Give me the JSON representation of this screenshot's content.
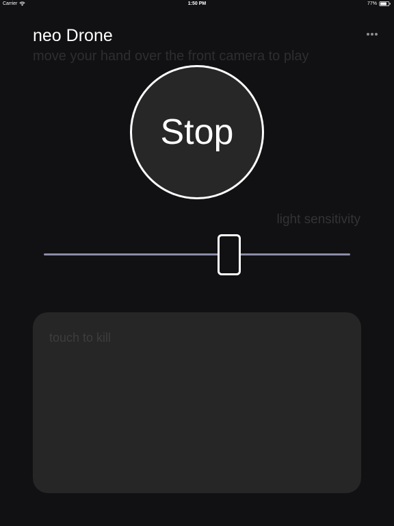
{
  "status_bar": {
    "carrier": "Carrier",
    "time": "1:50 PM",
    "battery": "77%",
    "battery_level": 0.77
  },
  "header": {
    "title": "neo Drone",
    "subtitle": "move your hand over the front camera to play",
    "more_icon": "ellipsis-icon"
  },
  "stop_button": {
    "label": "Stop"
  },
  "sensitivity": {
    "label": "light sensitivity",
    "value": 0.605
  },
  "kill_panel": {
    "label": "touch to kill"
  },
  "colors": {
    "background": "#111113",
    "panel": "#262626",
    "slider_track": "#8c8ca8",
    "accent": "#ffffff"
  }
}
